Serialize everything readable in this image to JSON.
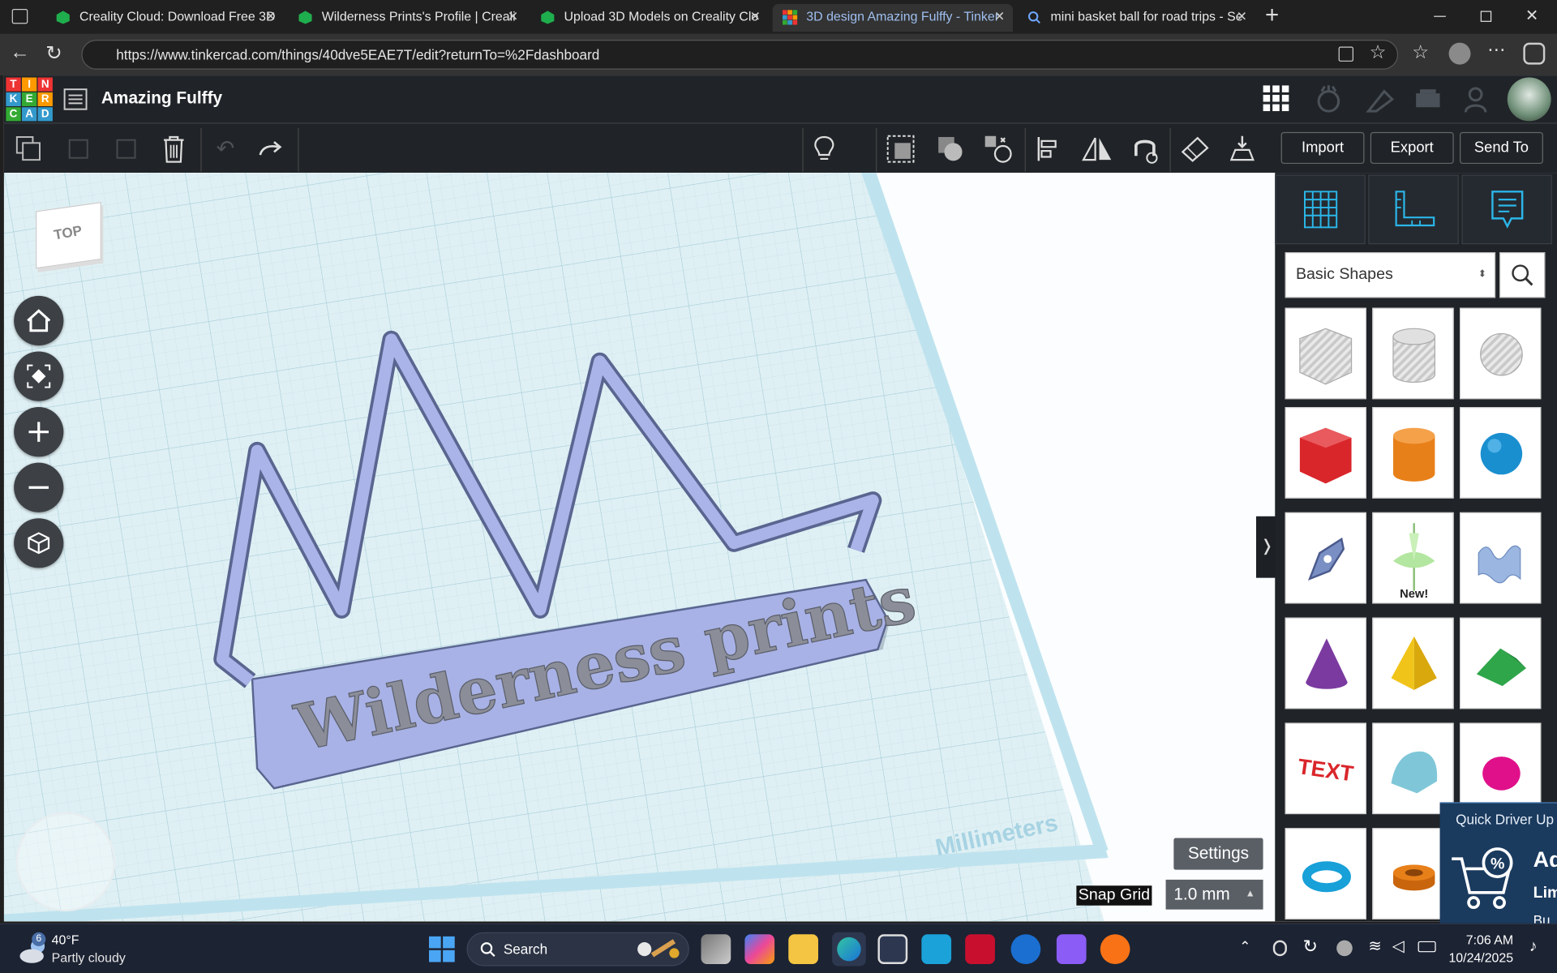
{
  "browser": {
    "tabs": [
      {
        "title": "Creality Cloud: Download Free 3D"
      },
      {
        "title": "Wilderness Prints's Profile | Creali"
      },
      {
        "title": "Upload 3D Models on Creality Clo"
      },
      {
        "title": "3D design Amazing Fulffy - Tinker"
      },
      {
        "title": "mini basket ball for road trips - Se"
      }
    ],
    "url": "https://www.tinkercad.com/things/40dve5EAE7T/edit?returnTo=%2Fdashboard"
  },
  "tinkercad": {
    "logo_letters": [
      "T",
      "I",
      "N",
      "K",
      "E",
      "R",
      "C",
      "A",
      "D"
    ],
    "design_title": "Amazing Fulffy",
    "actions": {
      "import": "Import",
      "export": "Export",
      "send_to": "Send To"
    },
    "viewcube_label": "TOP",
    "workplane_text": "Wilderness prints",
    "units_label": "Millimeters",
    "settings_label": "Settings",
    "snap_grid_label": "Snap Grid",
    "snap_grid_value": "1.0 mm",
    "shape_category": "Basic Shapes",
    "shape_new_badge": "New!",
    "shape_tiles": [
      {
        "name": "box-hole"
      },
      {
        "name": "cylinder-hole"
      },
      {
        "name": "sphere-hole"
      },
      {
        "name": "box",
        "color": "#d9262b"
      },
      {
        "name": "cylinder",
        "color": "#e8801a"
      },
      {
        "name": "sphere",
        "color": "#1a8fd0"
      },
      {
        "name": "scribble"
      },
      {
        "name": "spinner",
        "color": "#b3e6a0"
      },
      {
        "name": "shape-generator"
      },
      {
        "name": "cone",
        "color": "#7b3aa0"
      },
      {
        "name": "pyramid",
        "color": "#f0c419"
      },
      {
        "name": "roof",
        "color": "#2fa64a"
      },
      {
        "name": "text",
        "color": "#d9262b"
      },
      {
        "name": "half-cylinder",
        "color": "#7fc7d8"
      },
      {
        "name": "paraboloid",
        "color": "#e0108a"
      },
      {
        "name": "torus",
        "color": "#18a0d8"
      },
      {
        "name": "tube",
        "color": "#e8801a"
      }
    ]
  },
  "popup": {
    "title": "Quick Driver Up",
    "text1": "Ad",
    "text2": "Lim",
    "text3": "Bu"
  },
  "taskbar": {
    "weather_temp": "40°F",
    "weather_desc": "Partly cloudy",
    "weather_badge": "6",
    "search_label": "Search",
    "time": "7:06 AM",
    "date": "10/24/2025"
  }
}
